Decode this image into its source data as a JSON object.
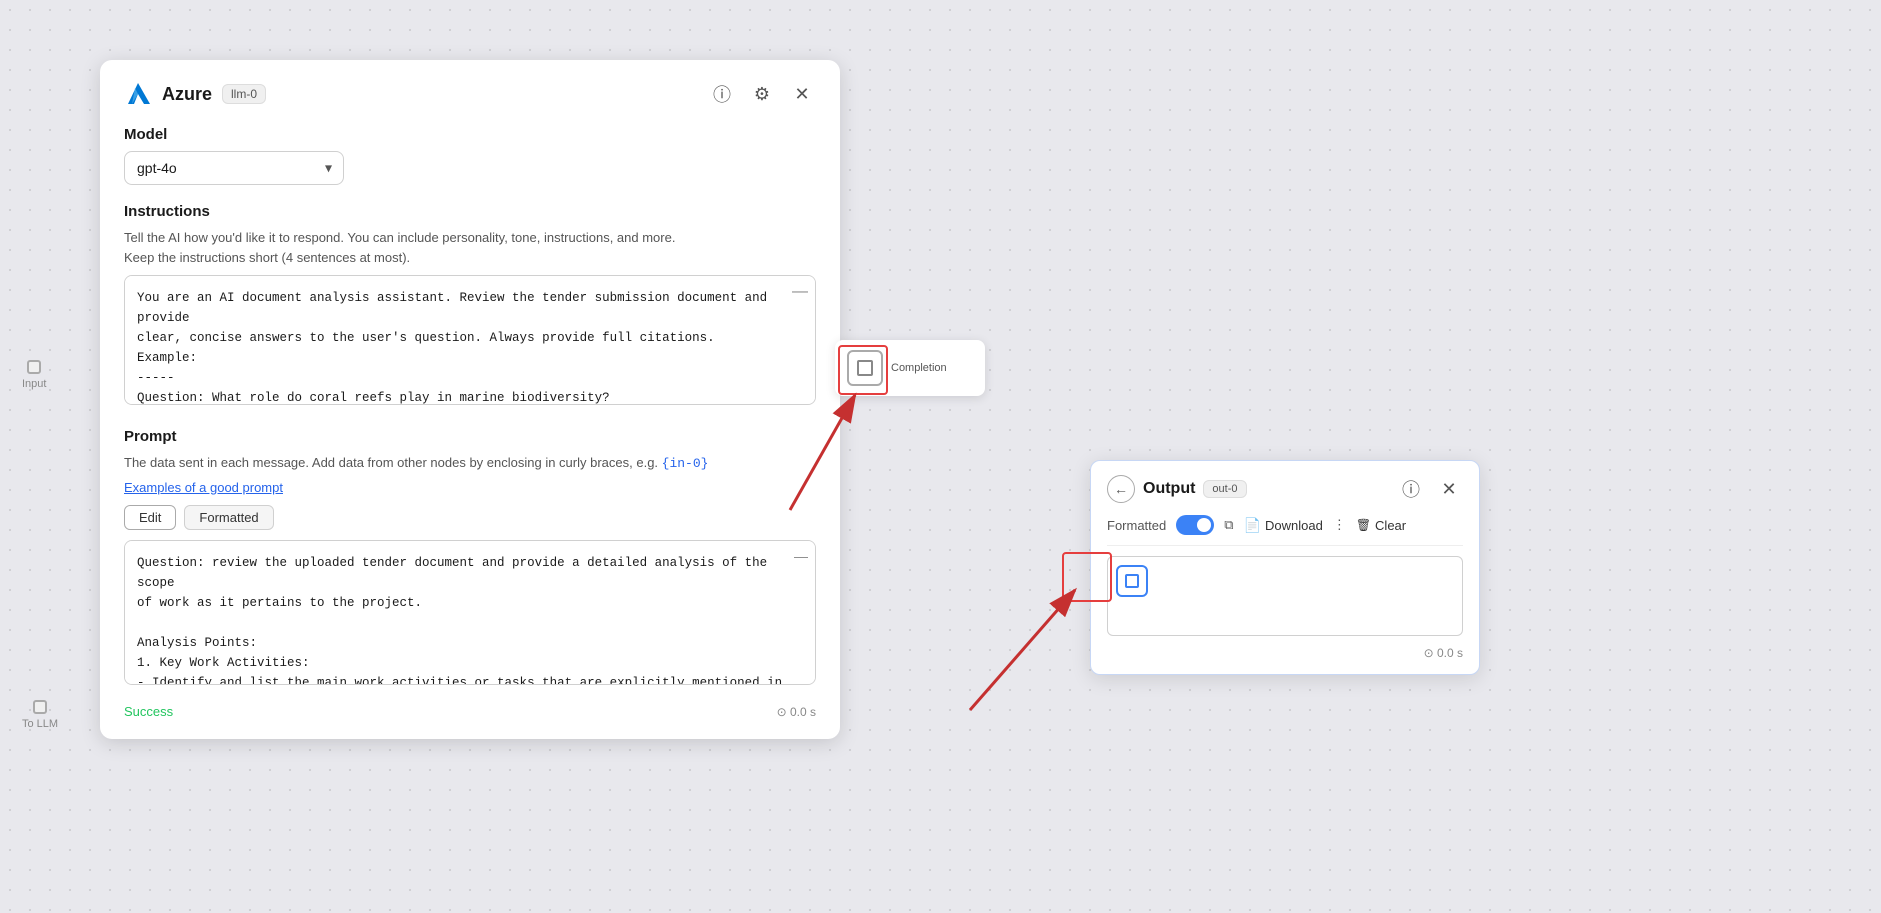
{
  "azure_panel": {
    "title": "Azure",
    "tag": "llm-0",
    "model_section": {
      "label": "Model",
      "selected_model": "gpt-4o"
    },
    "instructions_section": {
      "label": "Instructions",
      "description_line1": "Tell the AI how you'd like it to respond. You can include personality, tone, instructions, and more.",
      "description_line2": "Keep the instructions short (4 sentences at most).",
      "content": "You are an AI document analysis assistant. Review the tender submission document and provide\nclear, concise answers to the user's question. Always provide full citations.\nExample:\n-----\nQuestion: What role do coral reefs play in marine biodiversity?\nAnswer: Coral reefs are crucial to marine biodiversity, serving as habitats for about 25% of\nall marine species. The document Marine Ecosystems Overview (Chapter 3, p. 45) explains that..."
    },
    "prompt_section": {
      "label": "Prompt",
      "description": "The data sent in each message. Add data from other nodes by enclosing in curly braces, e.g. {in-0}",
      "curly_example": "{in-0}",
      "link_text": "Examples of a good prompt",
      "tab_edit": "Edit",
      "tab_formatted": "Formatted",
      "active_tab": "Edit",
      "content": "Question: review the uploaded tender document and provide a detailed analysis of the scope\nof work as it pertains to the project.\n\nAnalysis Points:\n1. Key Work Activities:\n- Identify and list the main work activities or tasks that are explicitly mentioned in the..."
    },
    "footer": {
      "status": "Success",
      "time": "⊙ 0.0 s"
    }
  },
  "completion_panel": {
    "label": "Completion"
  },
  "output_panel": {
    "title": "Output",
    "tag": "out-0",
    "toolbar": {
      "formatted_label": "Formatted",
      "download_label": "Download",
      "clear_label": "Clear"
    },
    "footer": {
      "time": "⊙ 0.0 s"
    }
  },
  "left_connector": {
    "label": "Input"
  },
  "bottom_connector": {
    "label": "To LLM"
  },
  "icons": {
    "info": "ⓘ",
    "gear": "⚙",
    "close": "✕",
    "back": "←",
    "copy": "⧉",
    "more": "⋮",
    "clock": "⊙",
    "download_doc": "📄"
  }
}
